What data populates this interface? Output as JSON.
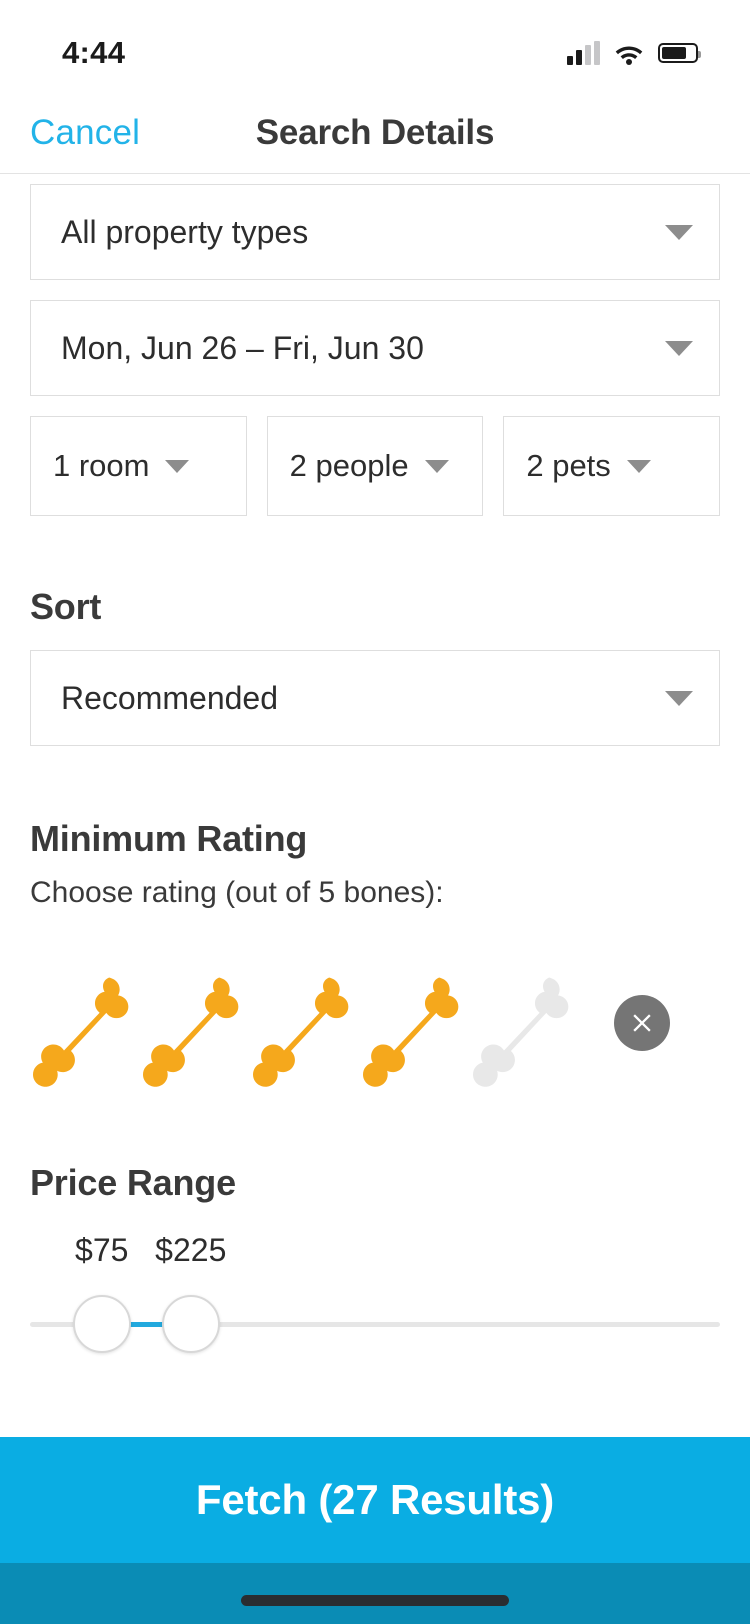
{
  "status_bar": {
    "time": "4:44",
    "signal_icon": "cellular-signal-icon",
    "wifi_icon": "wifi-icon",
    "battery_icon": "battery-icon"
  },
  "nav": {
    "cancel_label": "Cancel",
    "title": "Search Details"
  },
  "filters": {
    "property_type": {
      "value": "All property types",
      "caret_icon": "chevron-down-icon"
    },
    "dates": {
      "value": "Mon, Jun 26 – Fri, Jun 30",
      "caret_icon": "chevron-down-icon"
    },
    "rooms": {
      "value": "1 room",
      "caret_icon": "chevron-down-icon"
    },
    "people": {
      "value": "2 people",
      "caret_icon": "chevron-down-icon"
    },
    "pets": {
      "value": "2 pets",
      "caret_icon": "chevron-down-icon"
    }
  },
  "sort": {
    "heading": "Sort",
    "value": "Recommended",
    "caret_icon": "chevron-down-icon"
  },
  "rating": {
    "heading": "Minimum Rating",
    "subtitle": "Choose rating (out of 5 bones):",
    "max": 5,
    "selected": 4,
    "filled_color": "#F5A81C",
    "empty_color": "#E8E8E8",
    "clear_icon": "close-circle-icon",
    "clear_bg": "#757575",
    "bones": [
      {
        "index": 1,
        "state": "filled"
      },
      {
        "index": 2,
        "state": "filled"
      },
      {
        "index": 3,
        "state": "filled"
      },
      {
        "index": 4,
        "state": "filled"
      },
      {
        "index": 5,
        "state": "empty"
      }
    ]
  },
  "price": {
    "heading": "Price Range",
    "min_label": "$75",
    "max_label": "$225",
    "min_value": 75,
    "max_value": 225,
    "min_pct": 10.4,
    "max_pct": 23.3,
    "track_color": "#E6E6E6",
    "fill_color": "#22A9DE"
  },
  "footer": {
    "fetch_label": "Fetch (27 Results)",
    "fetch_color": "#0AADE3",
    "results_count": 27,
    "home_indicator": "home-indicator"
  },
  "theme": {
    "accent": "#22B3E8",
    "text_dark": "#3A3A3A",
    "border": "#DEDEDE"
  }
}
